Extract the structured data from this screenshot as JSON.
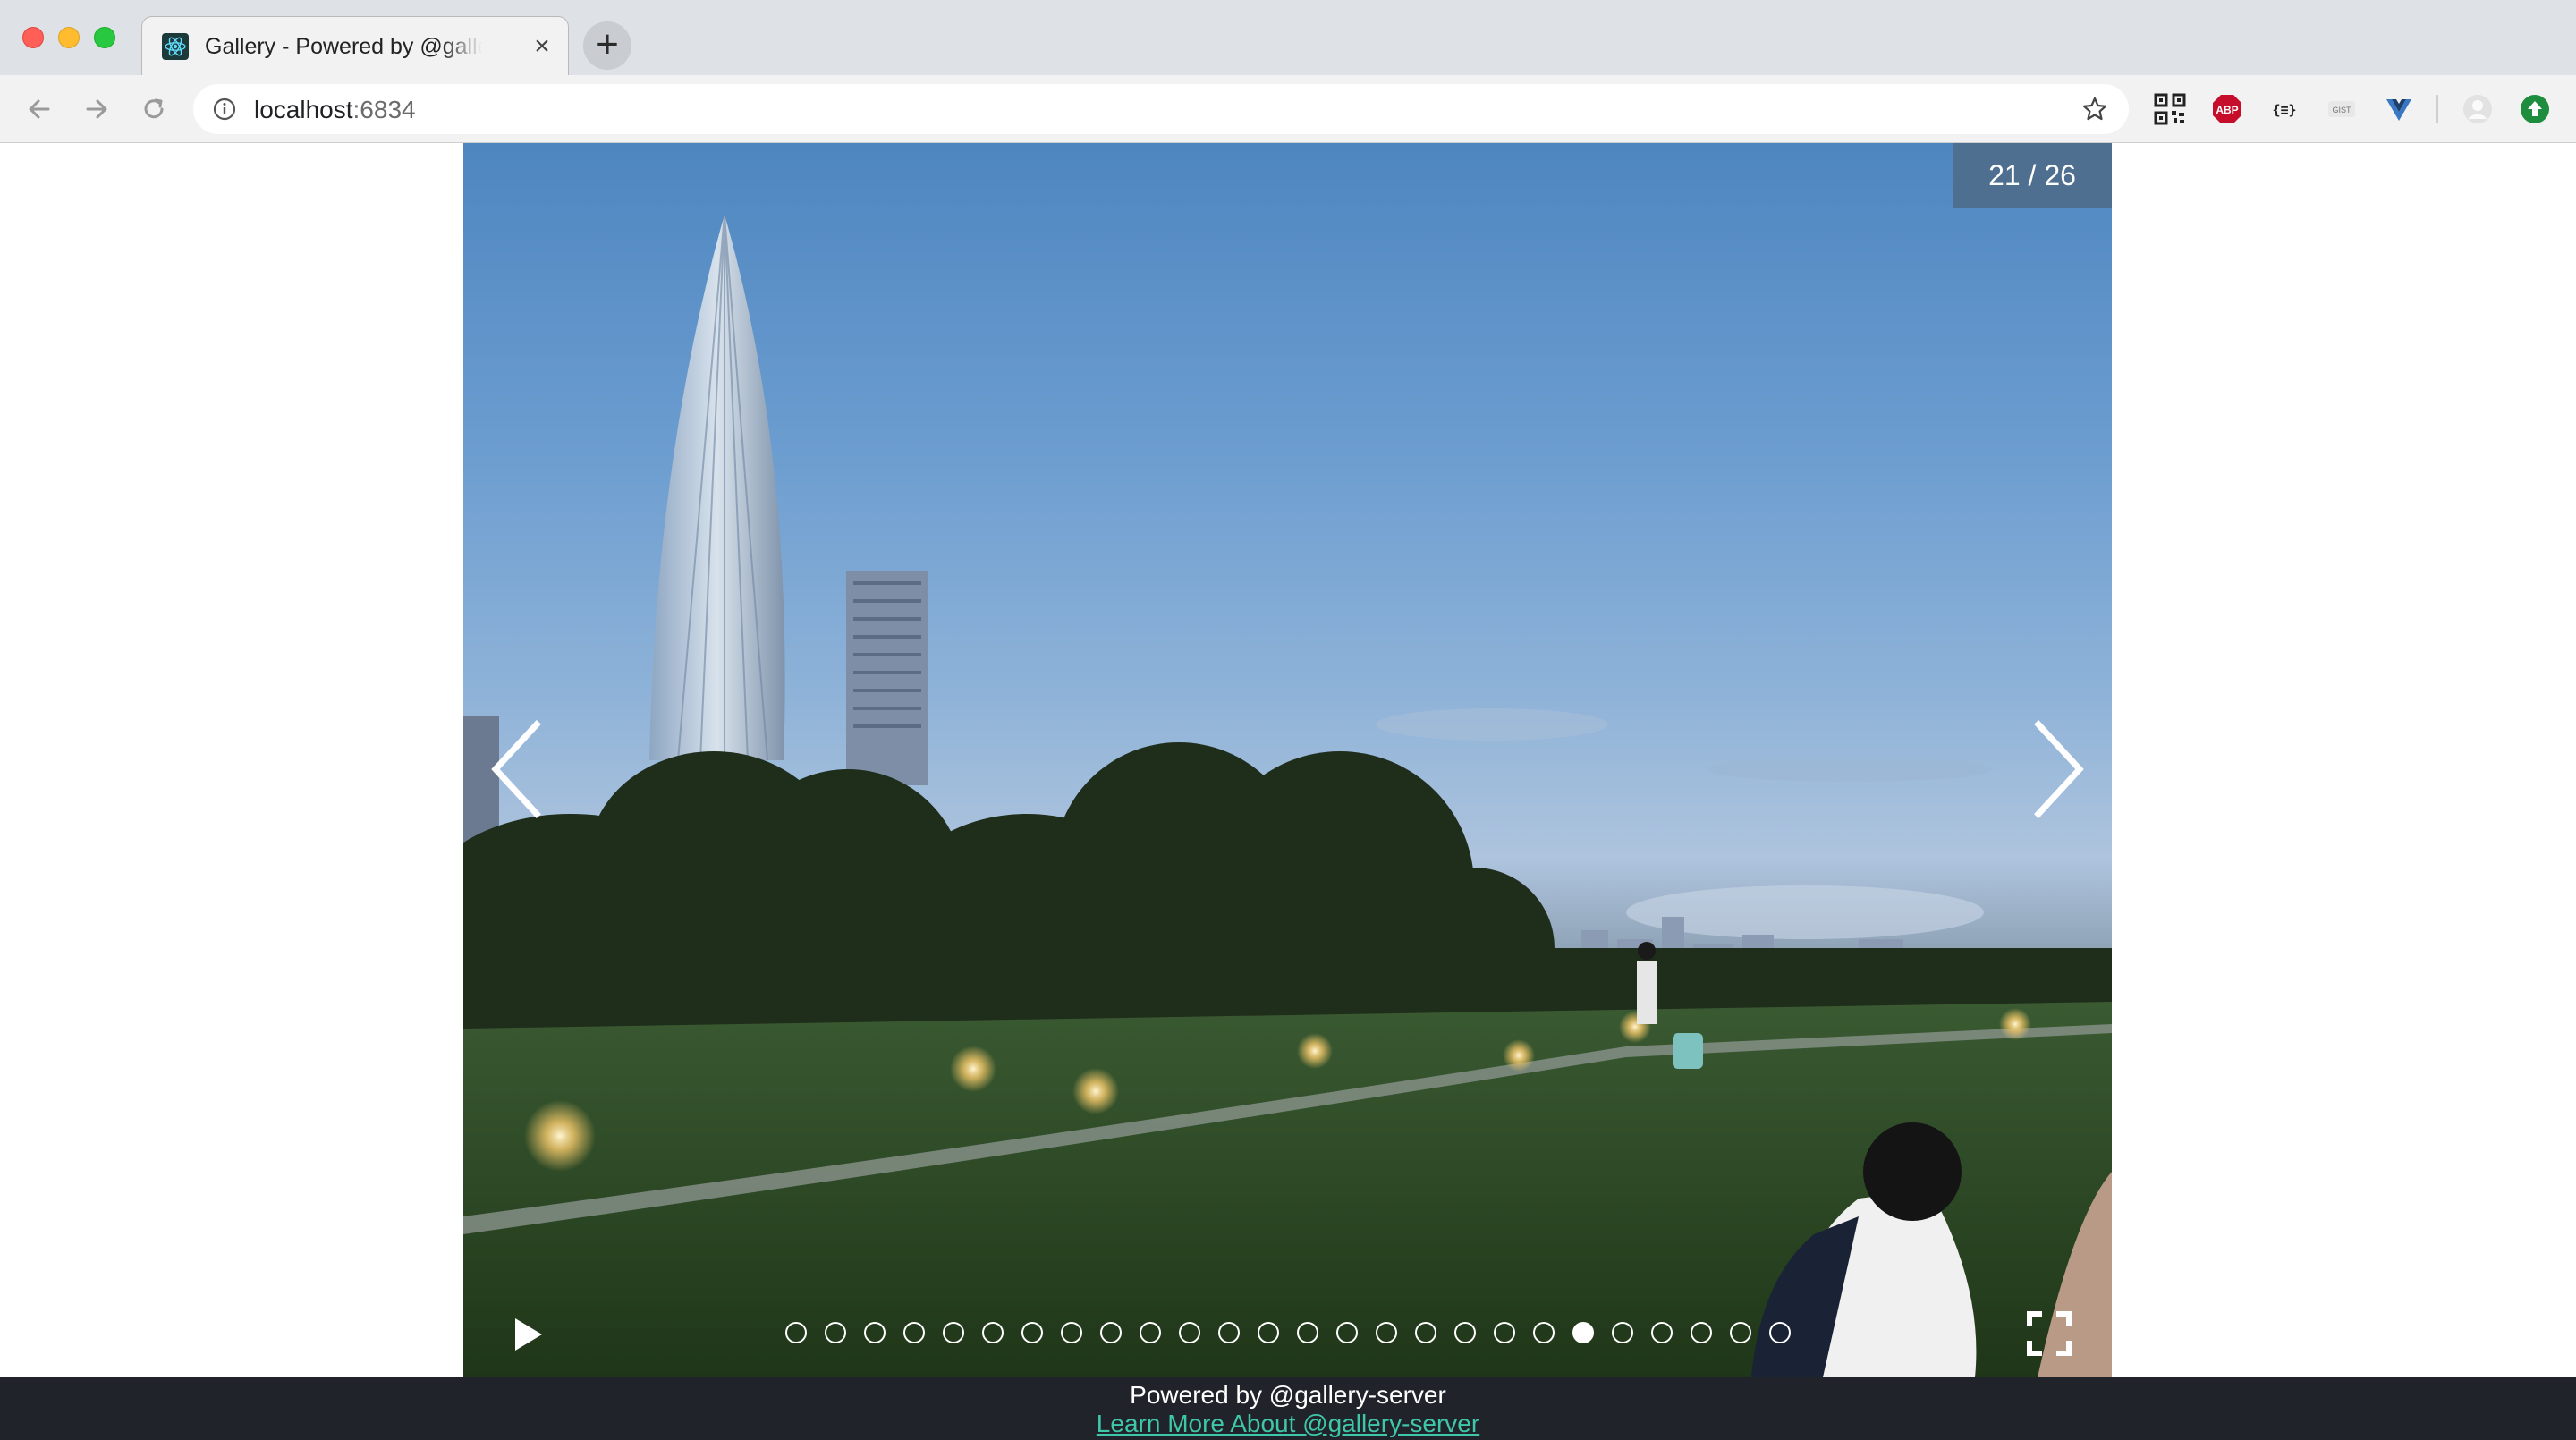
{
  "browser": {
    "tab_title": "Gallery - Powered by @gallery-server",
    "tab_close": "×",
    "new_tab": "+",
    "url_host": "localhost",
    "url_port": ":6834",
    "extensions": [
      "qr-code-icon",
      "adblock-plus-icon",
      "json-viewer-icon",
      "gist-icon",
      "vue-devtools-icon",
      "profile-avatar-icon",
      "update-icon"
    ],
    "extension_labels": {
      "adblock": "ABP",
      "json": "{≡}",
      "gist": "GIST"
    }
  },
  "gallery": {
    "counter": "21 / 26",
    "total": 26,
    "current_index": 21
  },
  "footer": {
    "text": "Powered by @gallery-server",
    "link": "Learn More About @gallery-server"
  },
  "colors": {
    "footer_bg": "#20232a",
    "link": "#3ec7a8",
    "counter_bg": "#4e6f8f"
  }
}
